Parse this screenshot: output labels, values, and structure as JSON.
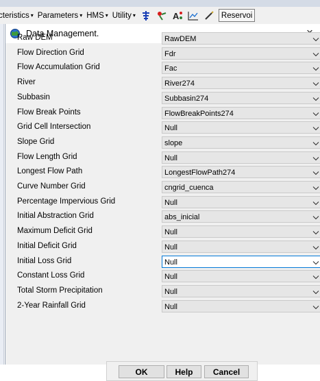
{
  "toolbar": {
    "menus": [
      {
        "label": "cteristics"
      },
      {
        "label": "Parameters"
      },
      {
        "label": "HMS"
      },
      {
        "label": "Utility"
      }
    ],
    "reservoir_label": "Reservoi"
  },
  "dialog": {
    "title": "Data Management.",
    "close_symbol": "×",
    "fields": [
      {
        "label": "Raw DEM",
        "value": "RawDEM"
      },
      {
        "label": "Flow Direction Grid",
        "value": "Fdr"
      },
      {
        "label": "Flow Accumulation Grid",
        "value": "Fac"
      },
      {
        "label": "River",
        "value": "River274"
      },
      {
        "label": "Subbasin",
        "value": "Subbasin274"
      },
      {
        "label": "Flow Break Points",
        "value": "FlowBreakPoints274"
      },
      {
        "label": "Grid Cell Intersection",
        "value": "Null"
      },
      {
        "label": "Slope Grid",
        "value": "slope"
      },
      {
        "label": "Flow Length Grid",
        "value": "Null"
      },
      {
        "label": "Longest Flow Path",
        "value": "LongestFlowPath274"
      },
      {
        "label": "Curve Number Grid",
        "value": "cngrid_cuenca"
      },
      {
        "label": "Percentage Impervious Grid",
        "value": "Null"
      },
      {
        "label": "Initial Abstraction Grid",
        "value": "abs_inicial"
      },
      {
        "label": "Maximum Deficit Grid",
        "value": "Null"
      },
      {
        "label": "Initial Deficit Grid",
        "value": "Null"
      },
      {
        "label": "Initial Loss Grid",
        "value": "Null"
      },
      {
        "label": "Constant Loss Grid",
        "value": "Null"
      },
      {
        "label": "Total Storm Precipitation",
        "value": "Null"
      },
      {
        "label": "2-Year Rainfall Grid",
        "value": "Null"
      }
    ],
    "buttons": {
      "ok": "OK",
      "help": "Help",
      "cancel": "Cancel"
    }
  }
}
